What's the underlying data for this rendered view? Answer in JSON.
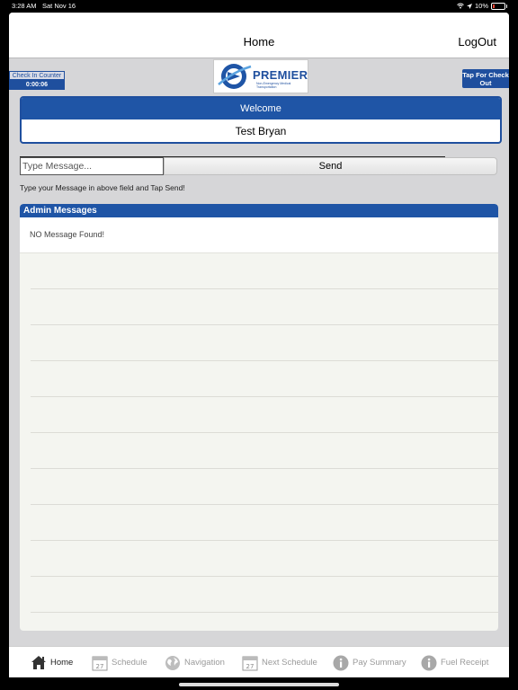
{
  "status": {
    "time": "3:28 AM",
    "date": "Sat Nov 16",
    "battery": "10%"
  },
  "navbar": {
    "title": "Home",
    "logout_label": "LogOut"
  },
  "checkin": {
    "label": "Check In Counter",
    "timer": "0:00:06"
  },
  "logo": {
    "brand": "PREMIER",
    "tagline": "Non-Emergency Medical Transportation"
  },
  "checkout": {
    "label": "Tap For Check Out"
  },
  "welcome": {
    "header": "Welcome",
    "name": "Test Bryan"
  },
  "message": {
    "placeholder": "Type Message...",
    "send_label": "Send",
    "hint": "Type your Message in above field and Tap Send!"
  },
  "admin": {
    "header": "Admin Messages",
    "empty_text": "NO Message Found!"
  },
  "tabs": [
    {
      "label": "Home",
      "icon": "home-icon",
      "active": true
    },
    {
      "label": "Schedule",
      "icon": "calendar-icon",
      "badge": "27"
    },
    {
      "label": "Navigation",
      "icon": "globe-icon"
    },
    {
      "label": "Next Schedule",
      "icon": "calendar-icon",
      "badge": "27"
    },
    {
      "label": "Pay Summary",
      "icon": "info-icon"
    },
    {
      "label": "Fuel Receipt",
      "icon": "info-icon"
    }
  ],
  "colors": {
    "primary": "#1f55a6",
    "dark_blue": "#1f4f9e",
    "panel": "#f4f5f0"
  }
}
